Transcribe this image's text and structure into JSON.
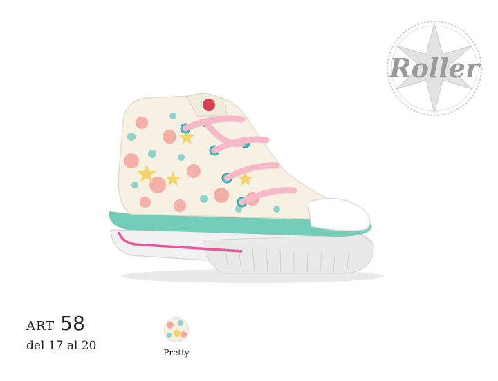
{
  "brand": {
    "logo_text": "Roller"
  },
  "product": {
    "art_label": "ART",
    "art_number": "58",
    "size_range": "del 17 al 20"
  },
  "variants": [
    {
      "label": "Pretty",
      "swatch_colors": [
        "#f6efdf",
        "#f4a9a0",
        "#8ed3cb",
        "#f3d36b"
      ]
    }
  ],
  "colors": {
    "canvas": "#f7f1e3",
    "laces": "#f6b9c8",
    "trim": "#74cdb7",
    "stripe": "#e8579a",
    "eyelets": "#3bbfc4",
    "sole": "#f3f3f3"
  }
}
